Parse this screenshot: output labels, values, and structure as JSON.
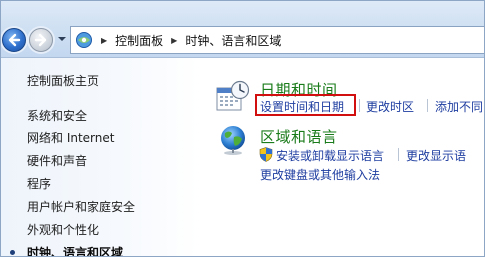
{
  "breadcrumb": {
    "items": [
      "控制面板",
      "时钟、语言和区域"
    ]
  },
  "sidebar": {
    "home": "控制面板主页",
    "items": [
      {
        "label": "系统和安全",
        "active": false
      },
      {
        "label": "网络和 Internet",
        "active": false
      },
      {
        "label": "硬件和声音",
        "active": false
      },
      {
        "label": "程序",
        "active": false
      },
      {
        "label": "用户帐户和家庭安全",
        "active": false
      },
      {
        "label": "外观和个性化",
        "active": false
      },
      {
        "label": "时钟、语言和区域",
        "active": true
      }
    ]
  },
  "categories": [
    {
      "title": "日期和时间",
      "icon": "calendar-clock-icon",
      "links": [
        "设置时间和日期",
        "更改时区",
        "添加不同"
      ]
    },
    {
      "title": "区域和语言",
      "icon": "globe-icon",
      "links": [
        "安装或卸载显示语言",
        "更改显示语",
        "更改键盘或其他输入法"
      ]
    }
  ],
  "colors": {
    "category_title": "#1a7b1a",
    "link": "#1f3ea0",
    "highlight": "#d20f0f"
  }
}
